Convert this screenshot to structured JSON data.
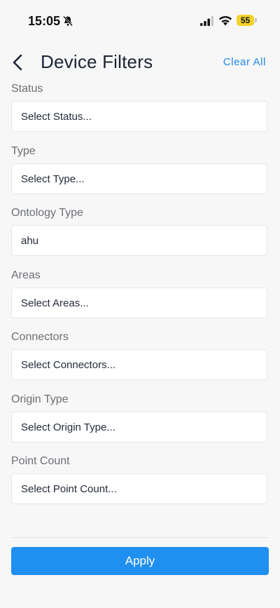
{
  "status_bar": {
    "time": "15:05",
    "battery_level": "55",
    "battery_color": "#f3d22a",
    "icons": [
      "bell-slash-icon",
      "cellular-signal-icon",
      "wifi-icon",
      "battery-icon"
    ]
  },
  "header": {
    "title": "Device Filters",
    "clear_label": "Clear All",
    "back_icon": "chevron-left-icon"
  },
  "filters": [
    {
      "label": "Status",
      "value": "Select Status..."
    },
    {
      "label": "Type",
      "value": "Select Type..."
    },
    {
      "label": "Ontology Type",
      "value": "ahu"
    },
    {
      "label": "Areas",
      "value": "Select Areas..."
    },
    {
      "label": "Connectors",
      "value": "Select Connectors..."
    },
    {
      "label": "Origin Type",
      "value": "Select Origin Type..."
    },
    {
      "label": "Point Count",
      "value": "Select Point Count..."
    }
  ],
  "footer": {
    "apply_label": "Apply",
    "accent_color": "#1f8ff0"
  }
}
